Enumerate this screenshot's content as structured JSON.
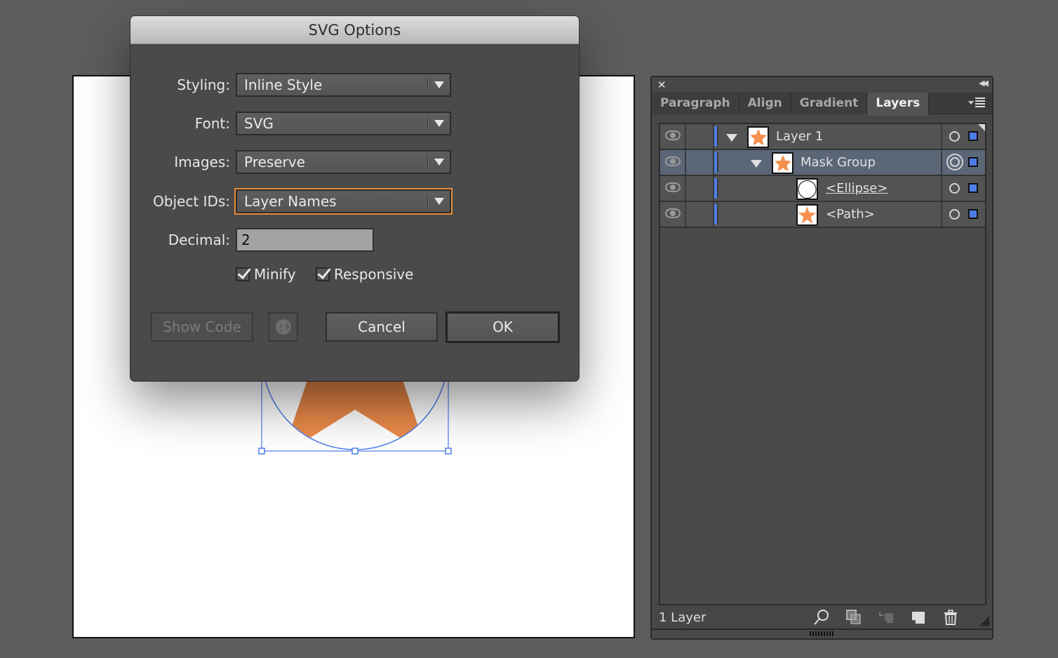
{
  "dialog": {
    "title": "SVG Options",
    "styling": {
      "label": "Styling:",
      "value": "Inline Style"
    },
    "font": {
      "label": "Font:",
      "value": "SVG"
    },
    "images": {
      "label": "Images:",
      "value": "Preserve"
    },
    "object_ids": {
      "label": "Object IDs:",
      "value": "Layer Names"
    },
    "decimal": {
      "label": "Decimal:",
      "value": "2"
    },
    "minify": {
      "label": "Minify",
      "checked": true
    },
    "responsive": {
      "label": "Responsive",
      "checked": true
    },
    "show_code_label": "Show Code",
    "cancel_label": "Cancel",
    "ok_label": "OK",
    "focus_color": "#e58a3a"
  },
  "panel": {
    "tabs": [
      {
        "label": "Paragraph",
        "active": false
      },
      {
        "label": "Align",
        "active": false
      },
      {
        "label": "Gradient",
        "active": false
      },
      {
        "label": "Layers",
        "active": true
      }
    ],
    "layers": [
      {
        "name": "Layer 1",
        "thumbnail": "star",
        "expanded": true,
        "selected": false,
        "target": "single"
      },
      {
        "name": "Mask Group",
        "thumbnail": "star",
        "expanded": true,
        "selected": true,
        "target": "double"
      },
      {
        "name": "<Ellipse>",
        "thumbnail": "circle",
        "expanded": false,
        "selected": false,
        "target": "single"
      },
      {
        "name": "<Path>",
        "thumbnail": "star",
        "expanded": false,
        "selected": false,
        "target": "single"
      }
    ],
    "layer_count": "1 Layer",
    "layer_color": "#4d7ee8"
  },
  "artwork": {
    "fill_top": "#b0622e",
    "fill_bottom": "#f5914e",
    "selection_color": "#4d7ee8"
  }
}
